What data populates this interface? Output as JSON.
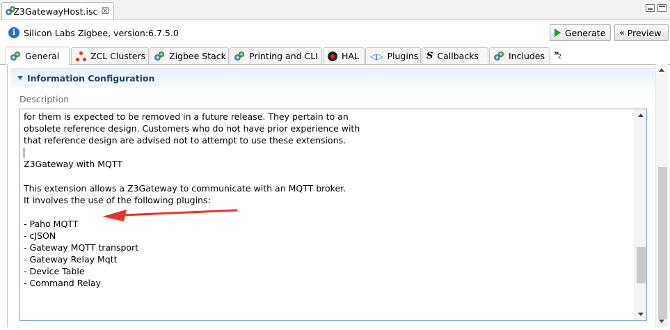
{
  "editor_tab": {
    "title": "*Z3GatewayHost.isc",
    "close_glyph": "☒"
  },
  "header": {
    "app_version": "Silicon Labs Zigbee, version:6.7.5.0",
    "generate_label": "Generate",
    "preview_label": "Preview"
  },
  "tabs": [
    {
      "label": "General"
    },
    {
      "label": "ZCL Clusters"
    },
    {
      "label": "Zigbee Stack"
    },
    {
      "label": "Printing and CLI"
    },
    {
      "label": "HAL"
    },
    {
      "label": "Plugins"
    },
    {
      "label": "Callbacks"
    },
    {
      "label": "Includes"
    }
  ],
  "overflow_tabs_count": "2",
  "section": {
    "title": "Information Configuration",
    "description_label": "Description",
    "description_text": "for them is expected to be removed in a future release. They pertain to an\nobsolete reference design. Customers who do not have prior experience with\nthat reference design are advised not to attempt to use these extensions.\n\nZ3Gateway with MQTT\n\nThis extension allows a Z3Gateway to communicate with an MQTT broker.\nIt involves the use of the following plugins:\n\n- Paho MQTT\n- cJSON\n- Gateway MQTT transport\n- Gateway Relay Mqtt\n- Device Table\n- Command Relay"
  },
  "colors": {
    "accent": "#2563b8",
    "annotation_arrow": "#e8332d",
    "textbox_border": "#7aa7d8"
  }
}
